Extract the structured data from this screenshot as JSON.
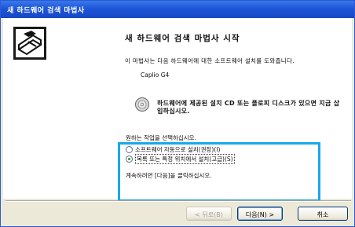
{
  "window": {
    "title": "새 하드웨어 검색 마법사"
  },
  "main": {
    "heading": "새 하드웨어 검색 마법사 시작",
    "intro": "이 마법사는 다음 하드웨어에 대한 소프트웨어 설치를 도와줍니다.",
    "device_name": "Caplio G4",
    "cd_note": "하드웨어에 제공된 설치 CD 또는 플로피 디스크가 있으면 지금 삽입하십시오.",
    "choose_prompt": "원하는 작업을 선택하십시오.",
    "options": [
      {
        "label": "소프트웨어 자동으로 설치(권장)(I)",
        "selected": false
      },
      {
        "label": "목록 또는 특정 위치에서 설치(고급)(S)",
        "selected": true
      }
    ],
    "continue_text": "계속하려면 [다음]을 클릭하십시오."
  },
  "buttons": {
    "back": "< 뒤로(B)",
    "next": "다음(N) >",
    "cancel": "취소"
  },
  "colors": {
    "titlebar": "#1d56d8",
    "highlight_box": "#18a8ec"
  }
}
